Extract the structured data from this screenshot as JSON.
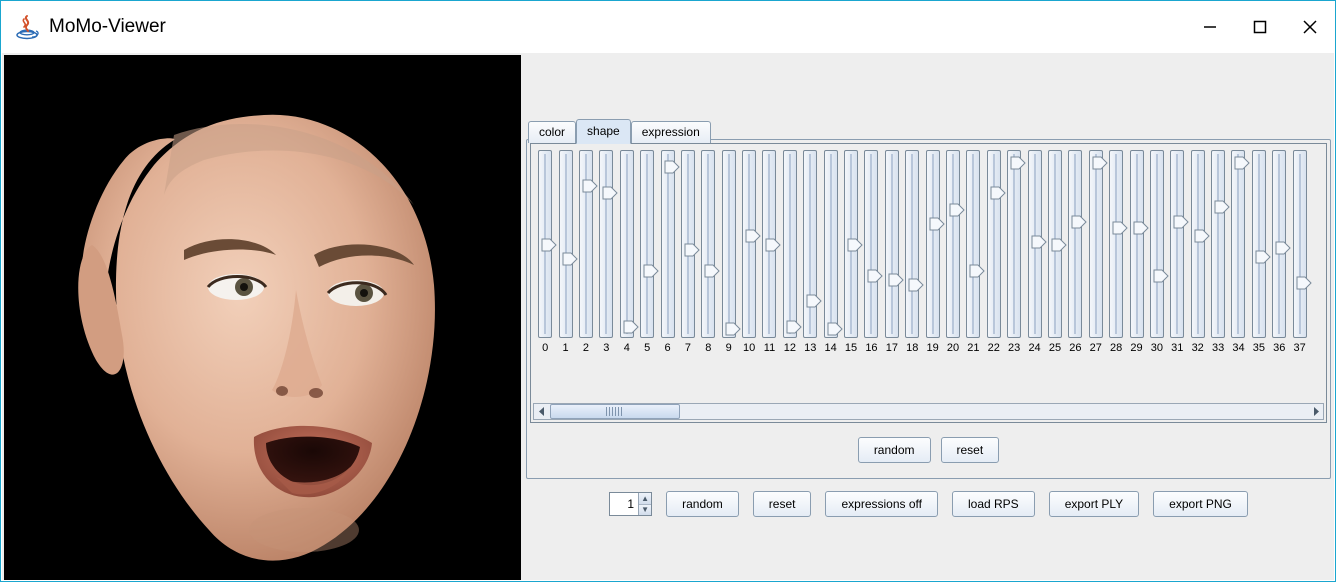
{
  "window": {
    "title": "MoMo-Viewer"
  },
  "tabs": {
    "items": [
      {
        "label": "color",
        "active": false
      },
      {
        "label": "shape",
        "active": true
      },
      {
        "label": "expression",
        "active": false
      }
    ]
  },
  "sliders": {
    "count_visible": 38,
    "items": [
      {
        "index": 0,
        "value": 0.5
      },
      {
        "index": 1,
        "value": 0.42
      },
      {
        "index": 2,
        "value": 0.84
      },
      {
        "index": 3,
        "value": 0.8
      },
      {
        "index": 4,
        "value": 0.03
      },
      {
        "index": 5,
        "value": 0.35
      },
      {
        "index": 6,
        "value": 0.95
      },
      {
        "index": 7,
        "value": 0.47
      },
      {
        "index": 8,
        "value": 0.35
      },
      {
        "index": 9,
        "value": 0.02
      },
      {
        "index": 10,
        "value": 0.55
      },
      {
        "index": 11,
        "value": 0.5
      },
      {
        "index": 12,
        "value": 0.03
      },
      {
        "index": 13,
        "value": 0.18
      },
      {
        "index": 14,
        "value": 0.02
      },
      {
        "index": 15,
        "value": 0.5
      },
      {
        "index": 16,
        "value": 0.32
      },
      {
        "index": 17,
        "value": 0.3
      },
      {
        "index": 18,
        "value": 0.27
      },
      {
        "index": 19,
        "value": 0.62
      },
      {
        "index": 20,
        "value": 0.7
      },
      {
        "index": 21,
        "value": 0.35
      },
      {
        "index": 22,
        "value": 0.8
      },
      {
        "index": 23,
        "value": 0.97
      },
      {
        "index": 24,
        "value": 0.52
      },
      {
        "index": 25,
        "value": 0.5
      },
      {
        "index": 26,
        "value": 0.63
      },
      {
        "index": 27,
        "value": 0.97
      },
      {
        "index": 28,
        "value": 0.6
      },
      {
        "index": 29,
        "value": 0.6
      },
      {
        "index": 30,
        "value": 0.32
      },
      {
        "index": 31,
        "value": 0.63
      },
      {
        "index": 32,
        "value": 0.55
      },
      {
        "index": 33,
        "value": 0.72
      },
      {
        "index": 34,
        "value": 0.97
      },
      {
        "index": 35,
        "value": 0.43
      },
      {
        "index": 36,
        "value": 0.48
      },
      {
        "index": 37,
        "value": 0.28
      }
    ]
  },
  "panel_buttons": {
    "random": "random",
    "reset": "reset"
  },
  "toolbar": {
    "spinner_value": "1",
    "random": "random",
    "reset": "reset",
    "expressions_off": "expressions off",
    "load_rps": "load RPS",
    "export_ply": "export PLY",
    "export_png": "export PNG"
  }
}
